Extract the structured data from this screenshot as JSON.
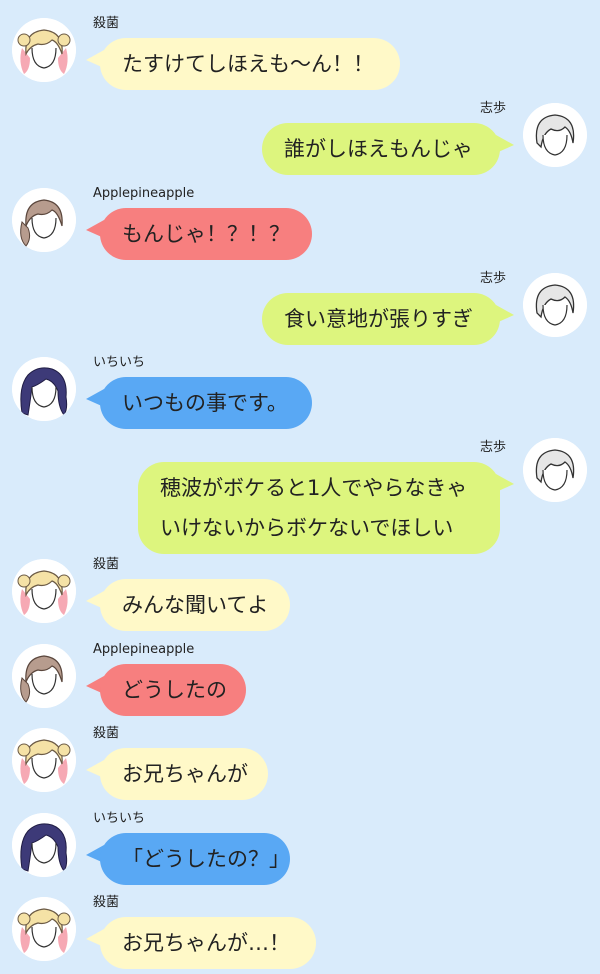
{
  "colors": {
    "background": "#d9ebfb",
    "yellow": "#fff9c8",
    "green": "#ddf57e",
    "red": "#f77f7f",
    "blue": "#59a8f4"
  },
  "messages": [
    {
      "side": "left",
      "sender": "殺菌",
      "avatar": "blonde-twintail-avatar-icon",
      "color": "#fff9c8",
      "lines": [
        "たすけてしほえも〜ん！！"
      ]
    },
    {
      "side": "right",
      "sender": "志歩",
      "avatar": "gray-hair-avatar-icon",
      "color": "#ddf57e",
      "lines": [
        "誰がしほえもんじゃ"
      ]
    },
    {
      "side": "left",
      "sender": "Applepineapple",
      "avatar": "brown-sidetail-avatar-icon",
      "color": "#f77f7f",
      "lines": [
        "もんじゃ！？！？"
      ]
    },
    {
      "side": "right",
      "sender": "志歩",
      "avatar": "gray-hair-avatar-icon",
      "color": "#ddf57e",
      "lines": [
        "食い意地が張りすぎ"
      ]
    },
    {
      "side": "left",
      "sender": "いちいち",
      "avatar": "navy-long-hair-avatar-icon",
      "color": "#59a8f4",
      "lines": [
        "いつもの事です。"
      ]
    },
    {
      "side": "right",
      "sender": "志歩",
      "avatar": "gray-hair-avatar-icon",
      "color": "#ddf57e",
      "lines": [
        "穂波がボケると1人でやらなきゃ",
        "いけないからボケないでほしい"
      ]
    },
    {
      "side": "left",
      "sender": "殺菌",
      "avatar": "blonde-twintail-avatar-icon",
      "color": "#fff9c8",
      "lines": [
        "みんな聞いてよ"
      ]
    },
    {
      "side": "left",
      "sender": "Applepineapple",
      "avatar": "brown-sidetail-avatar-icon",
      "color": "#f77f7f",
      "lines": [
        "どうしたの"
      ]
    },
    {
      "side": "left",
      "sender": "殺菌",
      "avatar": "blonde-twintail-avatar-icon",
      "color": "#fff9c8",
      "lines": [
        "お兄ちゃんが"
      ]
    },
    {
      "side": "left",
      "sender": "いちいち",
      "avatar": "navy-long-hair-avatar-icon",
      "color": "#59a8f4",
      "lines": [
        "「どうしたの？」"
      ]
    },
    {
      "side": "left",
      "sender": "殺菌",
      "avatar": "blonde-twintail-avatar-icon",
      "color": "#fff9c8",
      "lines": [
        "お兄ちゃんが…！"
      ]
    }
  ]
}
